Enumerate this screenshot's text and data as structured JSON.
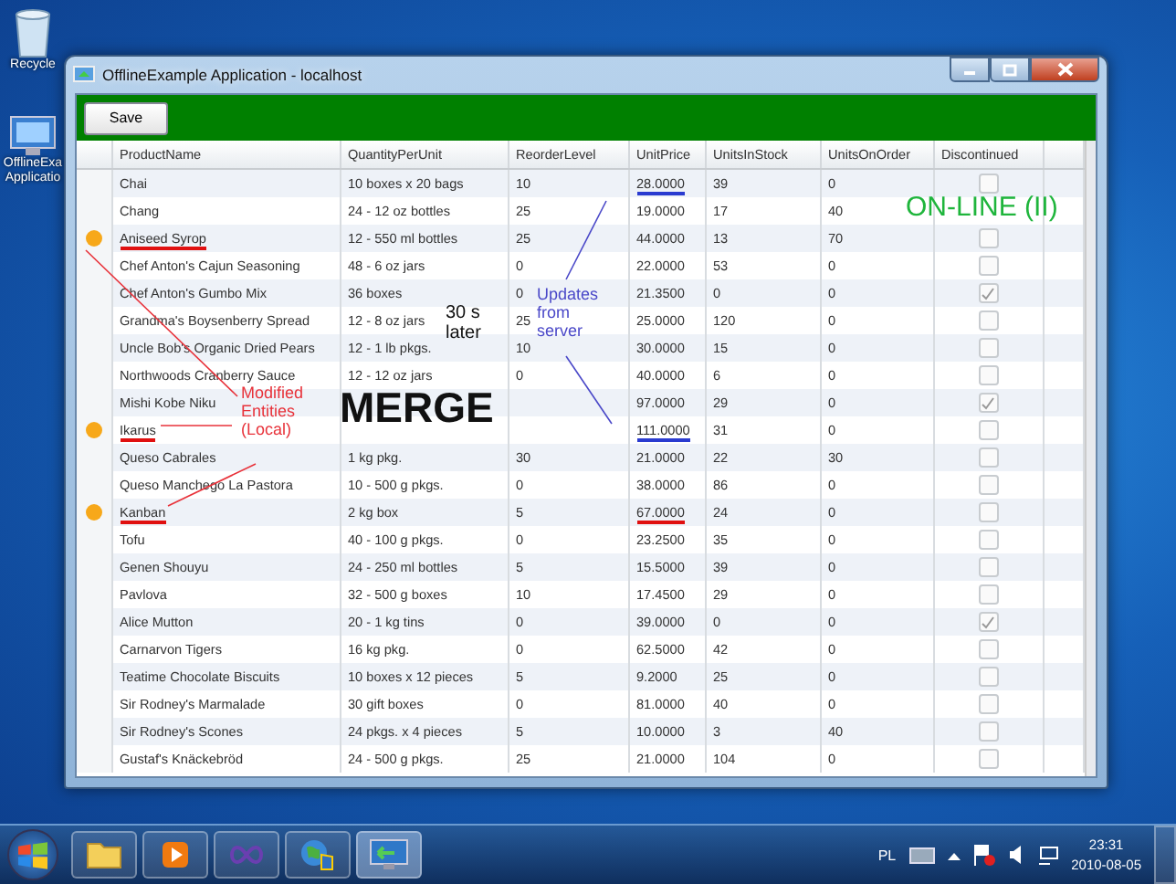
{
  "desktop": {
    "icons": [
      {
        "label": "Recycle"
      },
      {
        "label": "OfflineExa Applicatio"
      }
    ]
  },
  "window": {
    "title": "OfflineExample Application - localhost"
  },
  "toolbar": {
    "save_button": "Save"
  },
  "table": {
    "columns": [
      "ProductName",
      "QuantityPerUnit",
      "ReorderLevel",
      "UnitPrice",
      "UnitsInStock",
      "UnitsOnOrder",
      "Discontinued"
    ],
    "rows": [
      {
        "name": "Chai",
        "qty": "10 boxes x 20 bags",
        "reorder": "10",
        "price": "28.0000",
        "stock": "39",
        "order": "0",
        "discontinued": false,
        "modified": false,
        "price_changed_locally": false,
        "price_updated_from_server": true
      },
      {
        "name": "Chang",
        "qty": "24 - 12 oz bottles",
        "reorder": "25",
        "price": "19.0000",
        "stock": "17",
        "order": "40",
        "modified": false,
        "price_changed_locally": false,
        "price_updated_from_server": false
      },
      {
        "name": "Aniseed Syrop",
        "qty": "12 - 550 ml bottles",
        "reorder": "25",
        "price": "44.0000",
        "stock": "13",
        "order": "70",
        "discontinued": false,
        "modified": true,
        "price_changed_locally": false,
        "price_updated_from_server": false
      },
      {
        "name": "Chef Anton's Cajun Seasoning",
        "qty": "48 - 6 oz jars",
        "reorder": "0",
        "price": "22.0000",
        "stock": "53",
        "order": "0",
        "discontinued": false,
        "modified": false,
        "price_changed_locally": false,
        "price_updated_from_server": false
      },
      {
        "name": "Chef Anton's Gumbo Mix",
        "qty": "36 boxes",
        "reorder": "0",
        "price": "21.3500",
        "stock": "0",
        "order": "0",
        "discontinued": true,
        "modified": false,
        "price_changed_locally": false,
        "price_updated_from_server": false
      },
      {
        "name": "Grandma's Boysenberry Spread",
        "qty": "12 - 8 oz jars",
        "reorder": "25",
        "price": "25.0000",
        "stock": "120",
        "order": "0",
        "discontinued": false,
        "modified": false,
        "price_changed_locally": false,
        "price_updated_from_server": false
      },
      {
        "name": "Uncle Bob's Organic Dried Pears",
        "qty": "12 - 1 lb pkgs.",
        "reorder": "10",
        "price": "30.0000",
        "stock": "15",
        "order": "0",
        "discontinued": false,
        "modified": false,
        "price_changed_locally": false,
        "price_updated_from_server": false
      },
      {
        "name": "Northwoods Cranberry Sauce",
        "qty": "12 - 12 oz jars",
        "reorder": "0",
        "price": "40.0000",
        "stock": "6",
        "order": "0",
        "discontinued": false,
        "modified": false,
        "price_changed_locally": false,
        "price_updated_from_server": false
      },
      {
        "name": "Mishi Kobe Niku",
        "price": "97.0000",
        "stock": "29",
        "order": "0",
        "discontinued": true,
        "modified": false,
        "price_changed_locally": false,
        "price_updated_from_server": false
      },
      {
        "name": "Ikarus",
        "price": "111.0000",
        "stock": "31",
        "order": "0",
        "discontinued": false,
        "modified": true,
        "price_changed_locally": false,
        "price_updated_from_server": true
      },
      {
        "name": "Queso Cabrales",
        "qty": "1 kg pkg.",
        "reorder": "30",
        "price": "21.0000",
        "stock": "22",
        "order": "30",
        "discontinued": false,
        "modified": false,
        "price_changed_locally": false,
        "price_updated_from_server": false
      },
      {
        "name": "Queso Manchego La Pastora",
        "qty": "10 - 500 g pkgs.",
        "reorder": "0",
        "price": "38.0000",
        "stock": "86",
        "order": "0",
        "discontinued": false,
        "modified": false,
        "price_changed_locally": false,
        "price_updated_from_server": false
      },
      {
        "name": "Kanban",
        "qty": "2 kg box",
        "reorder": "5",
        "price": "67.0000",
        "stock": "24",
        "order": "0",
        "discontinued": false,
        "modified": true,
        "price_changed_locally": true,
        "price_updated_from_server": false
      },
      {
        "name": "Tofu",
        "qty": "40 - 100 g pkgs.",
        "reorder": "0",
        "price": "23.2500",
        "stock": "35",
        "order": "0",
        "discontinued": false,
        "modified": false,
        "price_changed_locally": false,
        "price_updated_from_server": false
      },
      {
        "name": "Genen Shouyu",
        "qty": "24 - 250 ml bottles",
        "reorder": "5",
        "price": "15.5000",
        "stock": "39",
        "order": "0",
        "discontinued": false,
        "modified": false,
        "price_changed_locally": false,
        "price_updated_from_server": false
      },
      {
        "name": "Pavlova",
        "qty": "32 - 500 g boxes",
        "reorder": "10",
        "price": "17.4500",
        "stock": "29",
        "order": "0",
        "discontinued": false,
        "modified": false,
        "price_changed_locally": false,
        "price_updated_from_server": false
      },
      {
        "name": "Alice Mutton",
        "qty": "20 - 1 kg tins",
        "reorder": "0",
        "price": "39.0000",
        "stock": "0",
        "order": "0",
        "discontinued": true,
        "modified": false,
        "price_changed_locally": false,
        "price_updated_from_server": false
      },
      {
        "name": "Carnarvon Tigers",
        "qty": "16 kg pkg.",
        "reorder": "0",
        "price": "62.5000",
        "stock": "42",
        "order": "0",
        "discontinued": false,
        "modified": false,
        "price_changed_locally": false,
        "price_updated_from_server": false
      },
      {
        "name": "Teatime Chocolate Biscuits",
        "qty": "10 boxes x 12 pieces",
        "reorder": "5",
        "price": "9.2000",
        "stock": "25",
        "order": "0",
        "discontinued": false,
        "modified": false,
        "price_changed_locally": false,
        "price_updated_from_server": false
      },
      {
        "name": "Sir Rodney's Marmalade",
        "qty": "30 gift boxes",
        "reorder": "0",
        "price": "81.0000",
        "stock": "40",
        "order": "0",
        "discontinued": false,
        "modified": false,
        "price_changed_locally": false,
        "price_updated_from_server": false
      },
      {
        "name": "Sir Rodney's Scones",
        "qty": "24 pkgs. x 4 pieces",
        "reorder": "5",
        "price": "10.0000",
        "stock": "3",
        "order": "40",
        "discontinued": false,
        "modified": false,
        "price_changed_locally": false,
        "price_updated_from_server": false
      },
      {
        "name": "Gustaf's Knäckebröd",
        "qty": "24 - 500 g pkgs.",
        "reorder": "25",
        "price": "21.0000",
        "stock": "104",
        "order": "0",
        "discontinued": false,
        "modified": false,
        "price_changed_locally": false,
        "price_updated_from_server": false
      }
    ]
  },
  "annotations": [
    {
      "text": "ON-LINE (II)",
      "color": "#1fb53c"
    },
    {
      "text": "30 s later",
      "color": "#111111"
    },
    {
      "text": "MERGE",
      "color": "#111111"
    },
    {
      "text": "Updates from server",
      "color": "#4a48c8"
    },
    {
      "text": "Modified Entities (Local)",
      "color": "#e8323a"
    }
  ],
  "taskbar": {
    "apps": [
      {
        "selected": false
      },
      {
        "selected": false
      },
      {
        "selected": false
      },
      {
        "selected": false
      },
      {
        "selected": true
      }
    ],
    "tray": {
      "language": "PL",
      "time": "23:31",
      "date": "2010-08-05"
    }
  }
}
